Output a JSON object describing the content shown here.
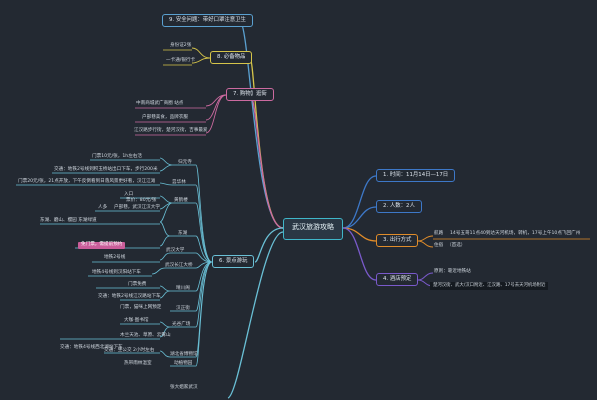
{
  "center": "武汉旅游攻略",
  "right": {
    "time": "1. 时间：11月14日—17日",
    "people": "2. 人数：2人",
    "transport": {
      "label": "3. 出行方式",
      "go_prefix": "航路",
      "go_detail": "14号五哥11点40到达天河机场，转机，17号上午10点飞回广州",
      "hotel_prefix": "住宿",
      "hotel_name": "（首选）"
    },
    "lodging": {
      "label": "4. 酒店预定",
      "l1": "原则：靠近地铁站",
      "l2": "楚河汉街、武大/汉口附近、江汉路、17号去天河机场附近"
    }
  },
  "left": {
    "safety": "9. 安全问题：带好口罩注意卫生",
    "goods": {
      "label": "8. 必备物品",
      "items": [
        "身份证2张",
        "一卡通/银行卡"
      ]
    },
    "shopping": {
      "label": "7. 购物】逛街",
      "items": [
        "中南商城武广商圈 站点",
        "户部巷美食，品牌衣服",
        "江汉路步行街，楚河汉街，吉事最爱"
      ]
    },
    "sights": {
      "label": "6. 景点游玩",
      "groups": [
        {
          "title": "归元寺",
          "items": [
            "门票10元/张，1h左右活",
            "交通：地铁2号线到积玉桥站出口下车，步行200米"
          ]
        },
        {
          "title": "昙华林",
          "items": [
            "门票20元/张，21点开放，下午反倒看到日落风景更好看，汉江江滩"
          ]
        },
        {
          "title": "黄鹤楼",
          "items": [
            "入口",
            "人多",
            "票价：80元/张",
            "户部巷，武汉江汉大学"
          ]
        },
        {
          "title": "东湖",
          "items": [
            "东湖、磨山、樱园 东湖绿道"
          ]
        },
        {
          "title": "武汉大学",
          "items": [
            "免门票，需提前预约",
            "地铁2号线"
          ]
        },
        {
          "title": "武汉长江大桥",
          "items": [
            "地铁4号线到汉阳站下车"
          ]
        },
        {
          "title": "晴川阁",
          "items": [
            "门票免费"
          ]
        },
        {
          "title": "汉正街",
          "items": [
            "交通：地铁2号线江汉路站下车",
            "门票，猫咪上网预定"
          ]
        },
        {
          "title": "光谷广场",
          "items": [
            "大咖·图书馆"
          ]
        },
        {
          "title": "湖北省博物馆",
          "items": [
            "木兰天池、草原、云雾山",
            "交通：地铁4号线西北湖站下车"
          ]
        },
        {
          "title": "动植物园",
          "items": [
            "交通：坐公交 2小时左右"
          ]
        },
        {
          "title": "园内",
          "items": [
            "热带雨林温室"
          ]
        }
      ]
    },
    "bottom": "张大姐家武汉"
  }
}
